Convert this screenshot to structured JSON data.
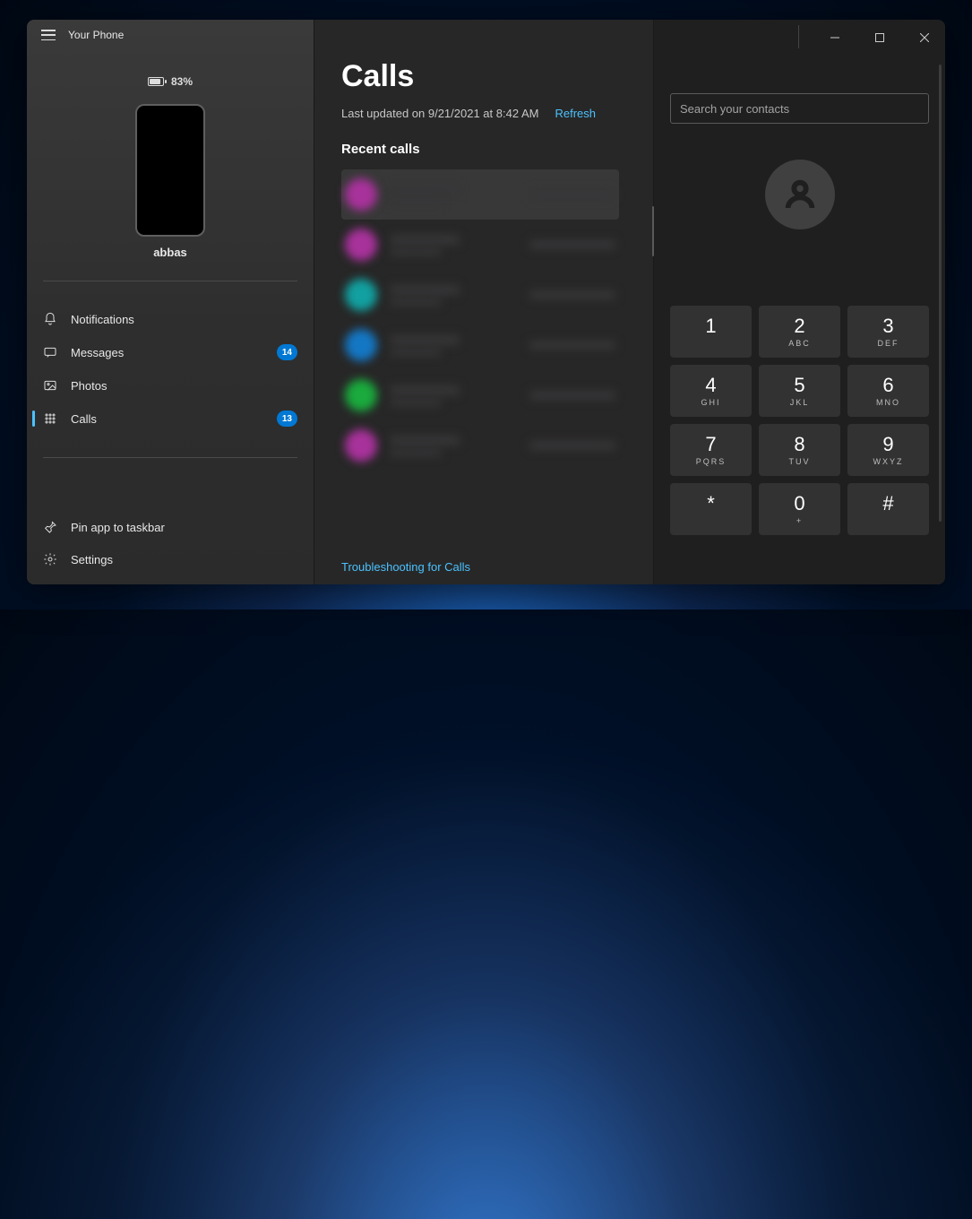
{
  "app_title": "Your Phone",
  "battery": {
    "percent": "83%"
  },
  "device_name": "abbas",
  "sidebar": {
    "notifications": "Notifications",
    "messages": "Messages",
    "messages_badge": "14",
    "photos": "Photos",
    "calls": "Calls",
    "calls_badge": "13",
    "pin": "Pin app to taskbar",
    "settings": "Settings"
  },
  "main": {
    "title": "Calls",
    "updated": "Last updated on 9/21/2021 at 8:42 AM",
    "refresh": "Refresh",
    "section": "Recent calls",
    "recent": [
      {
        "avatar_color": "#a8329b",
        "selected": true
      },
      {
        "avatar_color": "#a8329b"
      },
      {
        "avatar_color": "#12a0a0"
      },
      {
        "avatar_color": "#1477c4"
      },
      {
        "avatar_color": "#1aaa3d"
      },
      {
        "avatar_color": "#a8329b"
      }
    ],
    "troubleshoot": "Troubleshooting for Calls"
  },
  "right": {
    "search_placeholder": "Search your contacts",
    "keys": [
      {
        "n": "1",
        "s": ""
      },
      {
        "n": "2",
        "s": "ABC"
      },
      {
        "n": "3",
        "s": "DEF"
      },
      {
        "n": "4",
        "s": "GHI"
      },
      {
        "n": "5",
        "s": "JKL"
      },
      {
        "n": "6",
        "s": "MNO"
      },
      {
        "n": "7",
        "s": "PQRS"
      },
      {
        "n": "8",
        "s": "TUV"
      },
      {
        "n": "9",
        "s": "WXYZ"
      },
      {
        "n": "*",
        "s": ""
      },
      {
        "n": "0",
        "s": "+"
      },
      {
        "n": "#",
        "s": ""
      }
    ]
  }
}
